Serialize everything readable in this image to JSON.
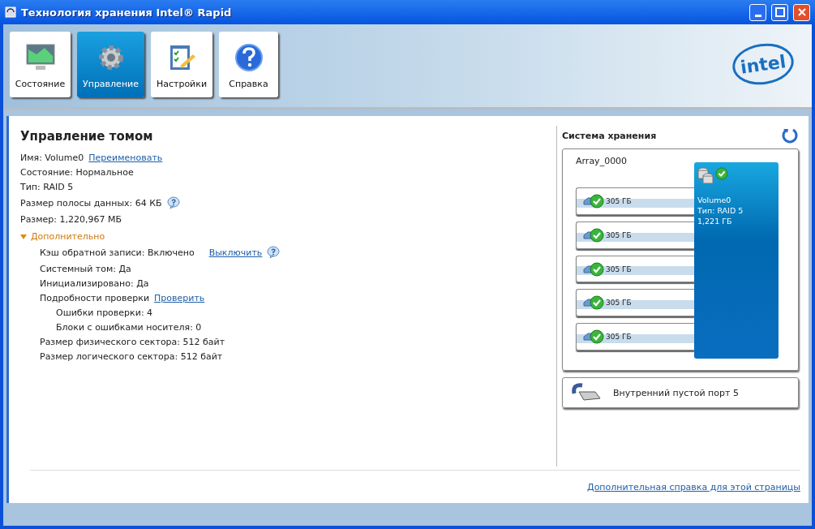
{
  "window": {
    "title": "Технология хранения Intel® Rapid"
  },
  "toolbar": [
    {
      "label": "Состояние",
      "selected": false
    },
    {
      "label": "Управление",
      "selected": true
    },
    {
      "label": "Настройки",
      "selected": false
    },
    {
      "label": "Справка",
      "selected": false
    }
  ],
  "logo": {
    "text": "intel"
  },
  "volume": {
    "heading": "Управление томом",
    "properties": [
      {
        "text": "Имя: Volume0",
        "link": "Переименовать",
        "help": false
      },
      {
        "text": "Состояние: Нормальное",
        "help": false
      },
      {
        "text": "Тип: RAID 5",
        "help": false
      },
      {
        "text": "Размер полосы данных: 64 КБ",
        "help": true
      },
      {
        "text": "Размер: 1,220,967 МБ",
        "help": false
      }
    ],
    "advanced": {
      "label": "Дополнительно",
      "expanded": true,
      "items": [
        {
          "text": "Кэш обратной записи: Включено",
          "link": "Выключить",
          "help": true
        },
        {
          "text": "Системный том: Да",
          "help": false
        },
        {
          "text": "Инициализировано: Да",
          "help": false
        },
        {
          "text": "Подробности проверки",
          "link": "Проверить",
          "help": false,
          "children": [
            {
              "text": "Ошибки проверки: 4",
              "help": false
            },
            {
              "text": "Блоки с ошибками носителя: 0",
              "help": false
            }
          ]
        },
        {
          "text": "Размер физического сектора: 512 байт",
          "help": false
        },
        {
          "text": "Размер логического сектора: 512 байт",
          "help": false
        }
      ]
    }
  },
  "storage": {
    "title": "Система хранения",
    "array": {
      "name": "Array_0000",
      "disks": [
        {
          "size": "305 ГБ"
        },
        {
          "size": "305 ГБ"
        },
        {
          "size": "305 ГБ"
        },
        {
          "size": "305 ГБ"
        },
        {
          "size": "305 ГБ"
        }
      ],
      "volume": {
        "name": "Volume0",
        "type": "Тип: RAID 5",
        "size": "1,221 ГБ"
      }
    },
    "ports": [
      {
        "label": "Внутренний пустой порт 5"
      }
    ]
  },
  "footer": {
    "link": "Дополнительная справка для этой страницы"
  }
}
